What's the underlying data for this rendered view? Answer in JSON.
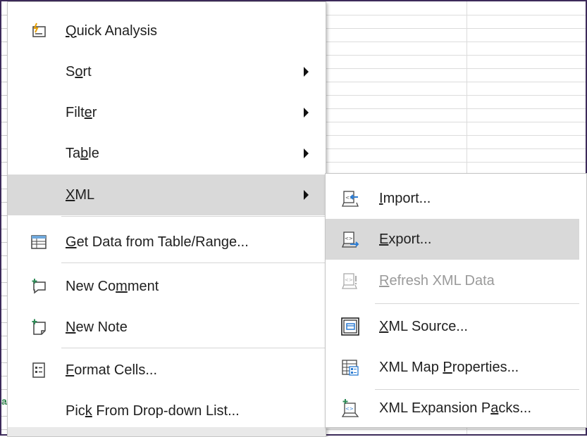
{
  "menu": {
    "items": [
      {
        "pre": "",
        "u": "Q",
        "post": "uick Analysis",
        "icon": "quick-analysis-icon",
        "has_submenu": false
      },
      {
        "pre": "S",
        "u": "o",
        "post": "rt",
        "icon": "",
        "has_submenu": true
      },
      {
        "pre": "Filt",
        "u": "e",
        "post": "r",
        "icon": "",
        "has_submenu": true
      },
      {
        "pre": "Ta",
        "u": "b",
        "post": "le",
        "icon": "",
        "has_submenu": true
      },
      {
        "pre": "",
        "u": "X",
        "post": "ML",
        "icon": "",
        "has_submenu": true,
        "highlighted": true
      },
      {
        "pre": "",
        "u": "G",
        "post": "et Data from Table/Range...",
        "icon": "table-data-icon",
        "has_submenu": false
      },
      {
        "pre": "New Co",
        "u": "m",
        "post": "ment",
        "icon": "new-comment-icon",
        "has_submenu": false
      },
      {
        "pre": "",
        "u": "N",
        "post": "ew Note",
        "icon": "new-note-icon",
        "has_submenu": false
      },
      {
        "pre": "",
        "u": "F",
        "post": "ormat Cells...",
        "icon": "format-cells-icon",
        "has_submenu": false
      },
      {
        "pre": "Pic",
        "u": "k",
        "post": " From Drop-down List...",
        "icon": "",
        "has_submenu": false
      }
    ]
  },
  "submenu": {
    "items": [
      {
        "pre": "",
        "u": "I",
        "post": "mport...",
        "icon": "xml-import-icon",
        "disabled": false
      },
      {
        "pre": "",
        "u": "E",
        "post": "xport...",
        "icon": "xml-export-icon",
        "disabled": false,
        "highlighted": true
      },
      {
        "pre": "",
        "u": "R",
        "post": "efresh XML Data",
        "icon": "xml-refresh-icon",
        "disabled": true
      },
      {
        "pre": "",
        "u": "X",
        "post": "ML Source...",
        "icon": "xml-source-icon",
        "disabled": false
      },
      {
        "pre": "XML Map ",
        "u": "P",
        "post": "roperties...",
        "icon": "xml-map-properties-icon",
        "disabled": false
      },
      {
        "pre": "XML Expansion P",
        "u": "a",
        "post": "cks...",
        "icon": "xml-expansion-packs-icon",
        "disabled": false
      }
    ]
  },
  "colors": {
    "highlight": "#d9d9d9",
    "accent_green": "#2e8b57",
    "accent_blue": "#2b7cd3",
    "disabled": "#9a9a9a"
  },
  "sheet": {
    "row_char": "a"
  }
}
